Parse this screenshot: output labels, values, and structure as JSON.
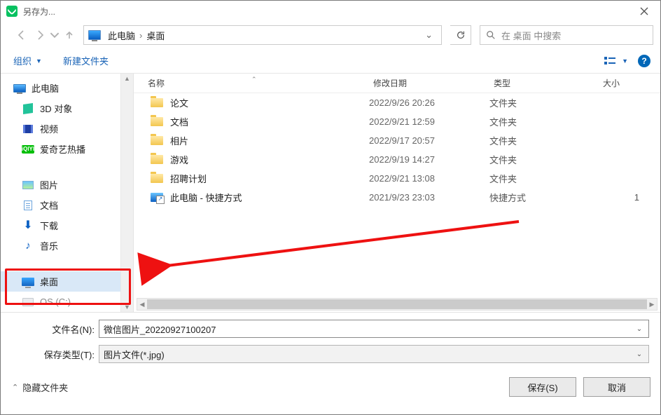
{
  "title": "另存为...",
  "breadcrumb": {
    "root": "此电脑",
    "leaf": "桌面"
  },
  "search": {
    "placeholder": "在 桌面 中搜索"
  },
  "toolbar": {
    "organize": "组织",
    "newfolder": "新建文件夹"
  },
  "columns": {
    "name": "名称",
    "date": "修改日期",
    "type": "类型",
    "size": "大小"
  },
  "tree": {
    "root": "此电脑",
    "items": [
      {
        "label": "3D 对象"
      },
      {
        "label": "视频"
      },
      {
        "label": "爱奇艺热播"
      },
      {
        "label": "图片"
      },
      {
        "label": "文档"
      },
      {
        "label": "下载"
      },
      {
        "label": "音乐"
      },
      {
        "label": "桌面"
      },
      {
        "label": "OS (C:)"
      }
    ]
  },
  "files": [
    {
      "name": "论文",
      "date": "2022/9/26 20:26",
      "type": "文件夹",
      "size": ""
    },
    {
      "name": "文档",
      "date": "2022/9/21 12:59",
      "type": "文件夹",
      "size": ""
    },
    {
      "name": "相片",
      "date": "2022/9/17 20:57",
      "type": "文件夹",
      "size": ""
    },
    {
      "name": "游戏",
      "date": "2022/9/19 14:27",
      "type": "文件夹",
      "size": ""
    },
    {
      "name": "招聘计划",
      "date": "2022/9/21 13:08",
      "type": "文件夹",
      "size": ""
    },
    {
      "name": "此电脑 - 快捷方式",
      "date": "2021/9/23 23:03",
      "type": "快捷方式",
      "size": "1"
    }
  ],
  "form": {
    "filename_label": "文件名(N):",
    "filename_value": "微信图片_20220927100207",
    "savetype_label": "保存类型(T):",
    "savetype_value": "图片文件(*.jpg)"
  },
  "footer": {
    "hide_folders": "隐藏文件夹",
    "save": "保存(S)",
    "cancel": "取消"
  }
}
